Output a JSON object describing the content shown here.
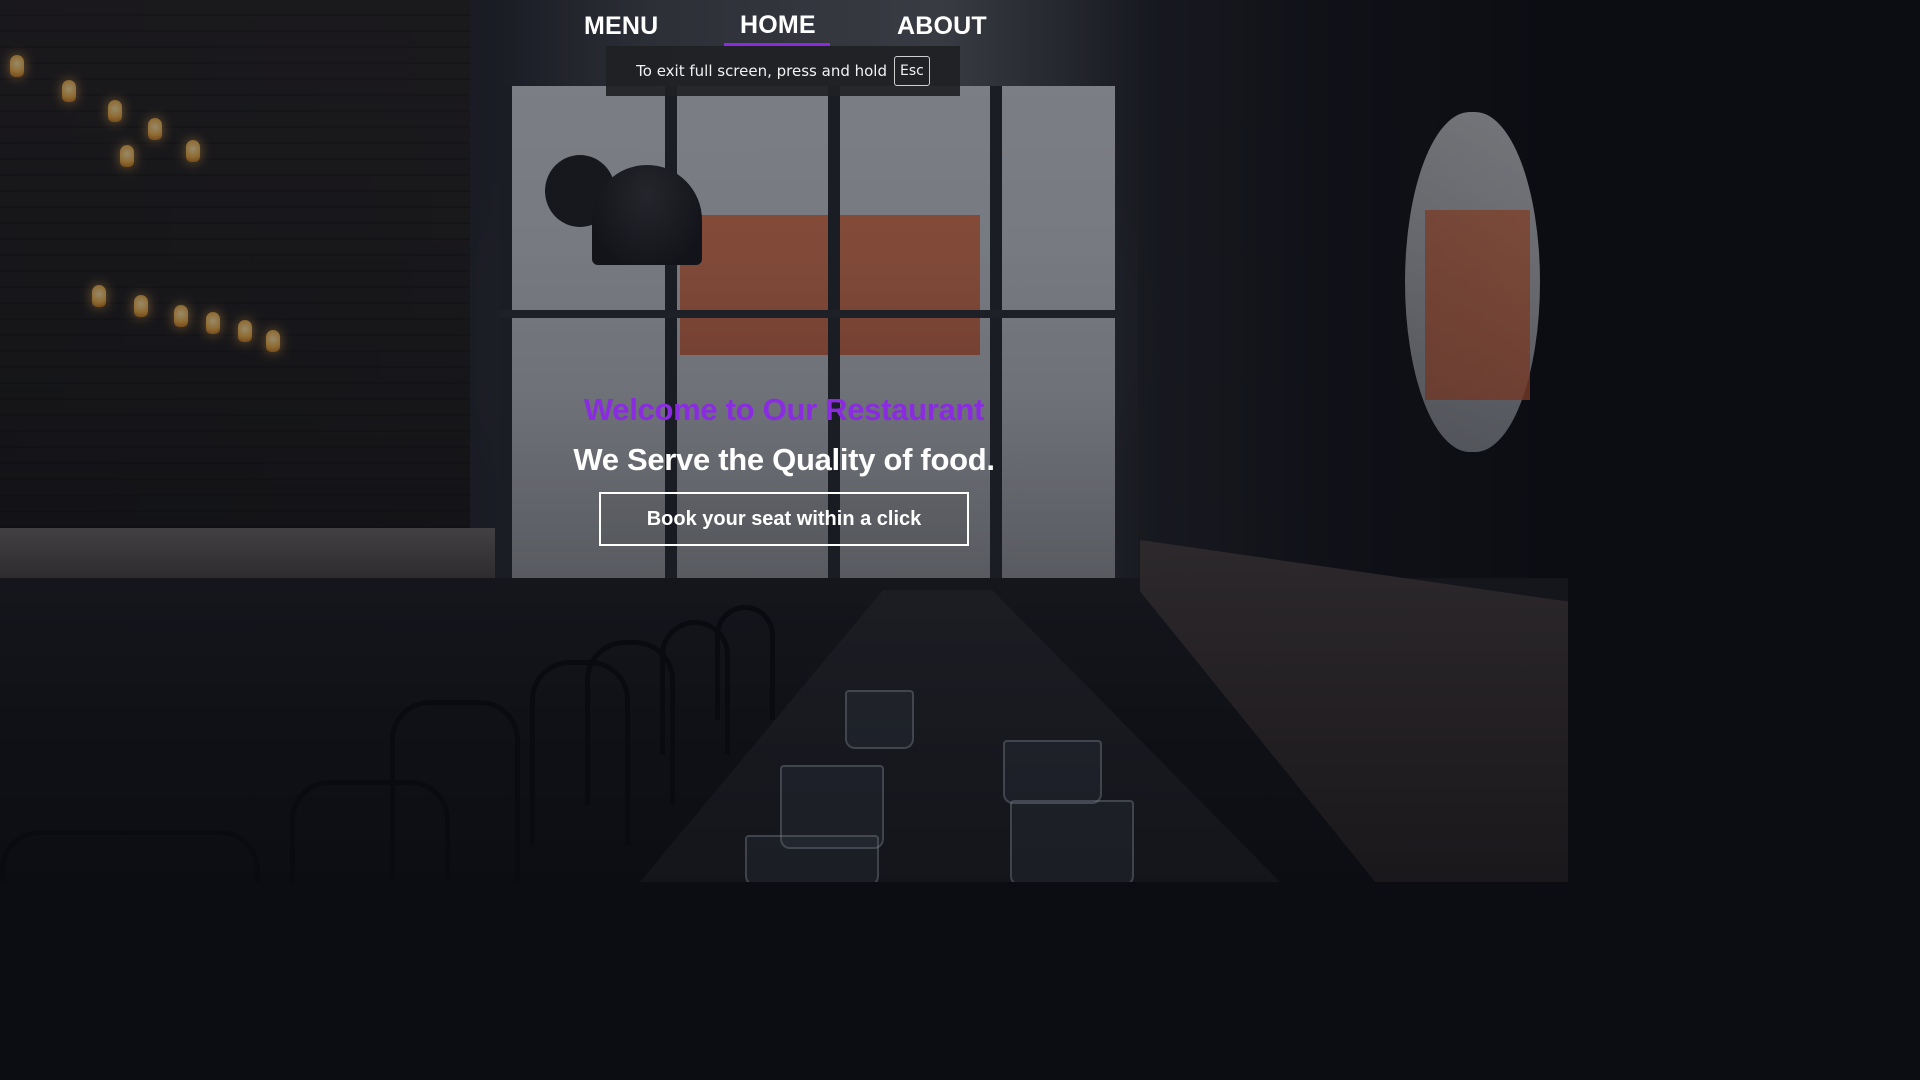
{
  "nav": {
    "items": [
      {
        "label": "MENU"
      },
      {
        "label": "HOME",
        "active": true
      },
      {
        "label": "ABOUT"
      }
    ],
    "active_color": "#8a2be2"
  },
  "fullscreen_toast": {
    "text": "To exit full screen, press and hold",
    "key": "Esc"
  },
  "hero": {
    "welcome": "Welcome to Our Restaurant",
    "tagline": "We Serve the Quality of food.",
    "button_label": "Book your seat within a click",
    "welcome_color": "#8a2be2"
  },
  "background": {
    "image": "restaurant-interior-photo"
  }
}
